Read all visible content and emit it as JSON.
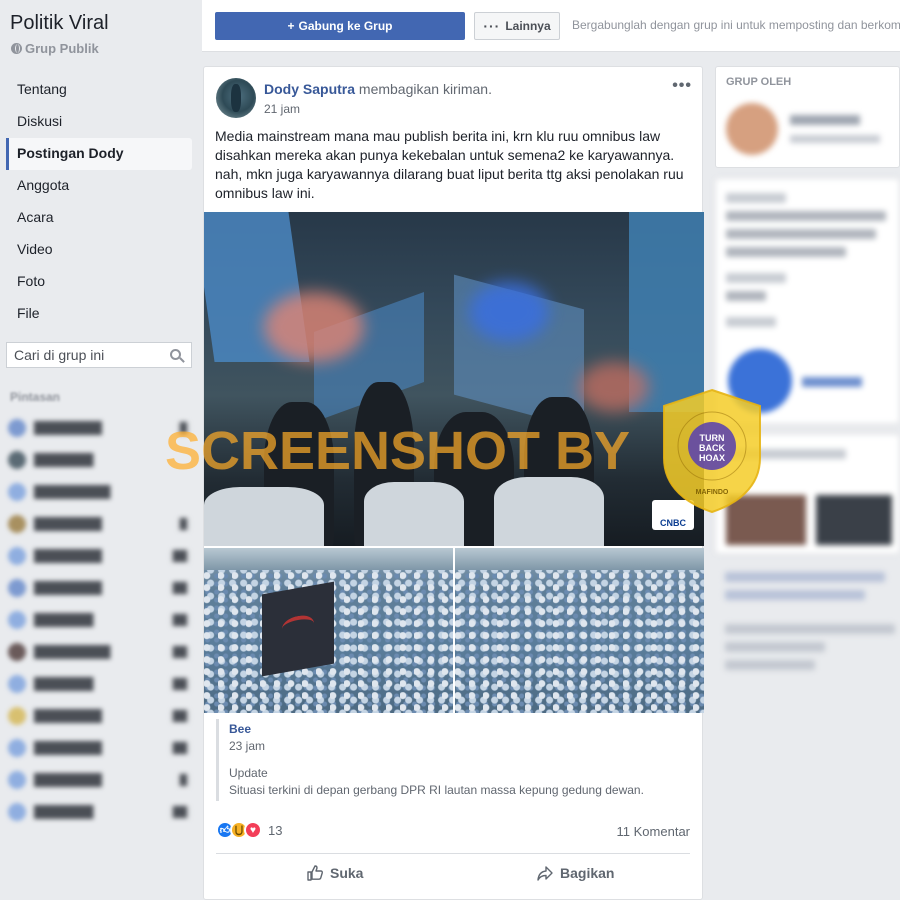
{
  "group": {
    "title": "Politik Viral",
    "privacy": "Grup Publik"
  },
  "nav": {
    "items": [
      {
        "label": "Tentang",
        "active": false
      },
      {
        "label": "Diskusi",
        "active": false
      },
      {
        "label": "Postingan Dody",
        "active": true
      },
      {
        "label": "Anggota",
        "active": false
      },
      {
        "label": "Acara",
        "active": false
      },
      {
        "label": "Video",
        "active": false
      },
      {
        "label": "Foto",
        "active": false
      },
      {
        "label": "File",
        "active": false
      }
    ],
    "search_placeholder": "Cari di grup ini"
  },
  "shortcuts": {
    "label": "Pintasan"
  },
  "topbar": {
    "join_label": "Gabung ke Grup",
    "more_label": "Lainnya",
    "hint": "Bergabunglah dengan grup ini untuk memposting dan berkom"
  },
  "post": {
    "author": "Dody Saputra",
    "action": "membagikan kiriman.",
    "time": "21 jam",
    "text": "Media mainstream mana mau publish berita ini, krn klu ruu omnibus law disahkan mereka akan punya kekebalan untuk semena2 ke karyawannya. nah, mkn juga karyawannya dilarang buat liput berita ttg aksi penolakan ruu omnibus law ini.",
    "shared": {
      "name": "Bee",
      "time": "23 jam",
      "update": "Update",
      "description": "Situasi terkini di depan gerbang DPR RI lautan massa kepung gedung dewan."
    },
    "reaction_count": "13",
    "comment_count": "11 Komentar",
    "like_label": "Suka",
    "share_label": "Bagikan"
  },
  "right": {
    "created_by_label": "GRUP OLEH"
  },
  "watermark": {
    "text": "SCREENSHOT BY",
    "badge_top": "MASYARAKAT ANTI FITNAH INDONESIA",
    "badge_line1": "TURN",
    "badge_line2": "BACK",
    "badge_line3": "HOAX",
    "badge_bottom": "MAFINDO"
  },
  "image_badge": "CNBC",
  "colors": {
    "brand": "#4267b2",
    "link": "#385898",
    "background": "#e9ebee"
  }
}
